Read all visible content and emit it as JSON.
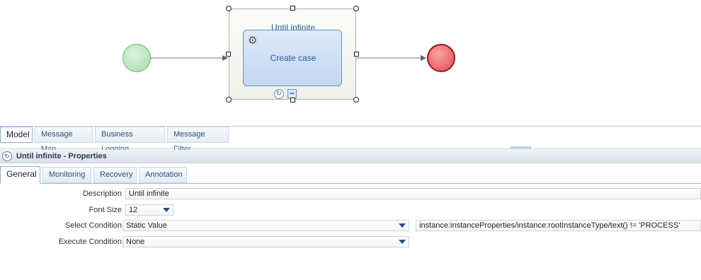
{
  "diagram": {
    "loop_title": "Until infinite",
    "task_label": "Create case",
    "colors": {
      "start": "#a4dcac",
      "end": "#e44a4a",
      "task": "#c3d7f0"
    }
  },
  "editor_tabs": [
    "Model",
    "Message Map",
    "Business Logging",
    "Message Filter"
  ],
  "properties": {
    "title": "Until infinite - Properties",
    "tabs": [
      "General",
      "Monitoring",
      "Recovery",
      "Annotation"
    ],
    "labels": {
      "description": "Description",
      "font_size": "Font Size",
      "select_condition": "Select Condition",
      "execute_condition": "Execute Condition"
    },
    "values": {
      "description": "Until infinite",
      "font_size": "12",
      "select_condition": "Static Value",
      "select_condition_expr": "instance:instanceProperties/instance:rootInstanceType/text() != 'PROCESS'",
      "execute_condition": "None"
    }
  }
}
